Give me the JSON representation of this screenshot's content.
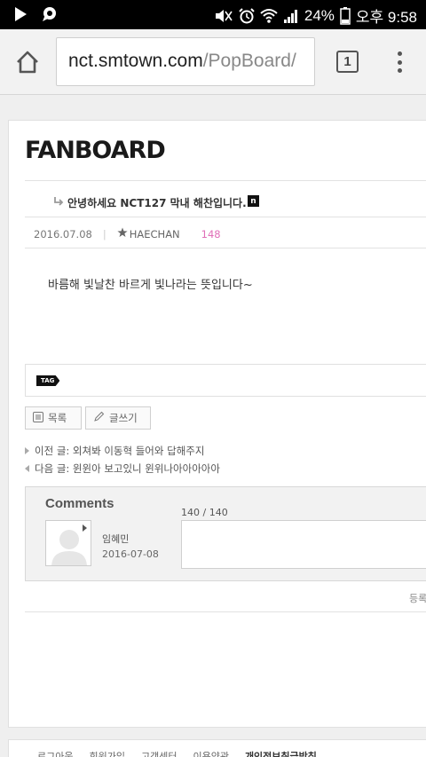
{
  "status_bar": {
    "battery": "24%",
    "time": "오후 9:58"
  },
  "browser": {
    "url_host": "nct.smtown.com",
    "url_path": "/PopBoard/",
    "tab_count": "1"
  },
  "board": {
    "logo": "FANBOARD",
    "post_title": "안녕하세요 NCT127 막내 해찬입니다.",
    "new_badge": "n",
    "date": "2016.07.08",
    "author": "HAECHAN",
    "views": "148",
    "body": "바름해 빛날찬 바르게 빛나라는 뜻입니다~",
    "tag_label": "TAG",
    "list_button": "목록",
    "write_button": "글쓰기",
    "prev_post": "이전 글: 외쳐봐 이동혁 들어와 답해주지",
    "next_post": "다음 글: 윈윈아 보고있니 윈위나아아아아아"
  },
  "comments": {
    "title": "Comments",
    "char_count": "140 / 140",
    "username": "임혜민",
    "date": "2016-07-08",
    "register_button": "등록"
  },
  "footer": {
    "links": [
      "로그아웃",
      "회원가입",
      "고객센터",
      "이용약관",
      "개인정보취급방침"
    ]
  }
}
